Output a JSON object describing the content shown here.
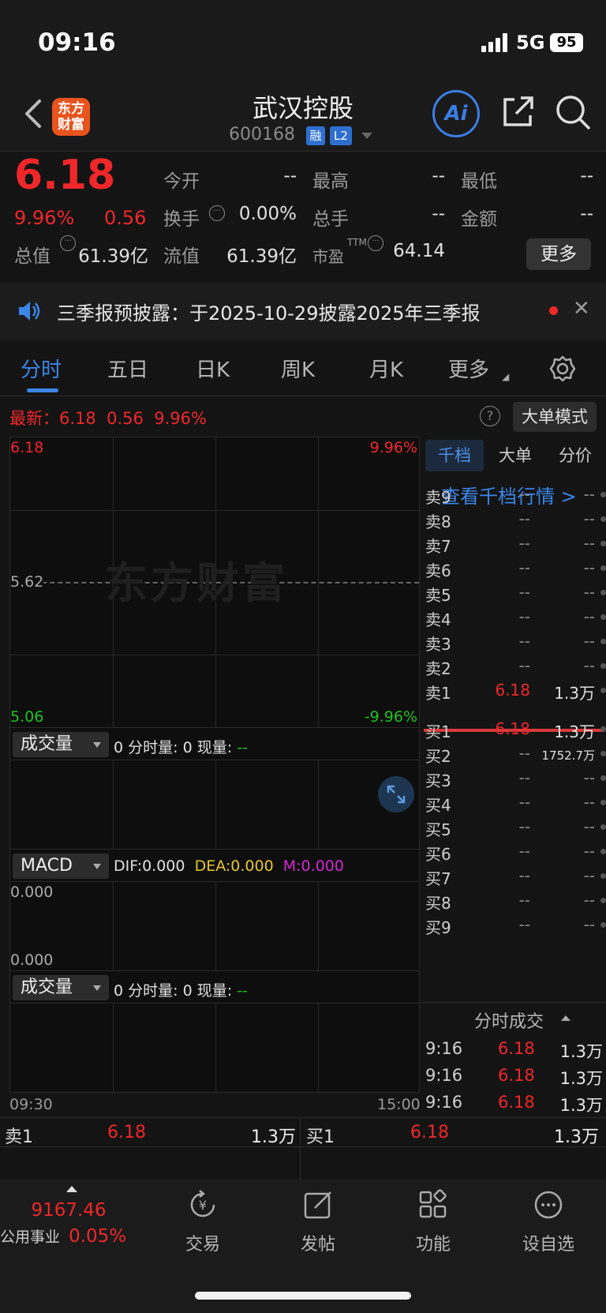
{
  "status": {
    "time": "09:16",
    "network": "5G",
    "battery": "95"
  },
  "header": {
    "title": "武汉控股",
    "code": "600168",
    "tag_margin": "融",
    "tag_level": "L2",
    "ai_label": "Ai"
  },
  "quote": {
    "price": "6.18",
    "change_pct": "9.96%",
    "change": "0.56",
    "open_label": "今开",
    "open": "--",
    "high_label": "最高",
    "high": "--",
    "low_label": "最低",
    "low": "--",
    "turnover_label": "换手",
    "turnover": "0.00%",
    "volume_label": "总手",
    "volume": "--",
    "amount_label": "金额",
    "amount": "--",
    "mktcap_label": "总值",
    "mktcap": "61.39亿",
    "float_label": "流值",
    "float": "61.39亿",
    "pe_label": "市盈",
    "pe_sup": "TTM",
    "pe": "64.14",
    "more": "更多"
  },
  "notice": {
    "text": "三季报预披露：于2025-10-29披露2025年三季报"
  },
  "tabs": [
    "分时",
    "五日",
    "日K",
    "周K",
    "月K",
    "更多"
  ],
  "latest": {
    "label": "最新：",
    "price": "6.18",
    "change": "0.56",
    "pct": "9.96%",
    "mode_btn": "大单模式",
    "help": "?"
  },
  "chart": {
    "top_price": "6.18",
    "top_pct": "9.96%",
    "mid_price": "5.62",
    "bottom_price": "5.06",
    "bottom_pct": "-9.96%",
    "watermark": "东方财富",
    "start_time": "09:30",
    "end_time": "15:00"
  },
  "volume1": {
    "label": "成交量",
    "text_a": "0",
    "lbl_a": "分时量:",
    "text_b": "0",
    "lbl_b": "现量:",
    "text_c": "--"
  },
  "macd": {
    "label": "MACD",
    "dif": "DIF:0.000",
    "dea": "DEA:0.000",
    "m": "M:0.000",
    "top": "0.000",
    "bottom": "0.000"
  },
  "volume2": {
    "label": "成交量",
    "text_a": "0",
    "lbl_a": "分时量:",
    "text_b": "0",
    "lbl_b": "现量:",
    "text_c": "--"
  },
  "book": {
    "tabs": [
      "千档",
      "大单",
      "分价"
    ],
    "view_link": "查看千档行情 >",
    "asks": [
      {
        "label": "卖9",
        "price": "--",
        "vol": "--"
      },
      {
        "label": "卖8",
        "price": "--",
        "vol": "--"
      },
      {
        "label": "卖7",
        "price": "--",
        "vol": "--"
      },
      {
        "label": "卖6",
        "price": "--",
        "vol": "--"
      },
      {
        "label": "卖5",
        "price": "--",
        "vol": "--"
      },
      {
        "label": "卖4",
        "price": "--",
        "vol": "--"
      },
      {
        "label": "卖3",
        "price": "--",
        "vol": "--"
      },
      {
        "label": "卖2",
        "price": "--",
        "vol": "--"
      },
      {
        "label": "卖1",
        "price": "6.18",
        "vol": "1.3万"
      }
    ],
    "bids": [
      {
        "label": "买1",
        "price": "6.18",
        "vol": "1.3万"
      },
      {
        "label": "买2",
        "price": "--",
        "vol": "1752.7万"
      },
      {
        "label": "买3",
        "price": "--",
        "vol": "--"
      },
      {
        "label": "买4",
        "price": "--",
        "vol": "--"
      },
      {
        "label": "买5",
        "price": "--",
        "vol": "--"
      },
      {
        "label": "买6",
        "price": "--",
        "vol": "--"
      },
      {
        "label": "买7",
        "price": "--",
        "vol": "--"
      },
      {
        "label": "买8",
        "price": "--",
        "vol": "--"
      },
      {
        "label": "买9",
        "price": "--",
        "vol": "--"
      }
    ],
    "ticks_title": "分时成交",
    "ticks": [
      {
        "time": "9:16",
        "price": "6.18",
        "vol": "1.3万"
      },
      {
        "time": "9:16",
        "price": "6.18",
        "vol": "1.3万"
      },
      {
        "time": "9:16",
        "price": "6.18",
        "vol": "1.3万"
      }
    ]
  },
  "quote_row": {
    "left_label": "卖1",
    "left_price": "6.18",
    "left_vol": "1.3万",
    "right_label": "买1",
    "right_price": "6.18",
    "right_vol": "1.3万"
  },
  "nav": {
    "index_value": "9167.46",
    "index_name": "公用事业",
    "index_pct": "0.05%",
    "items": [
      "交易",
      "发帖",
      "功能",
      "设自选"
    ]
  },
  "colors": {
    "up": "#f0272a",
    "down": "#1ec31e",
    "accent": "#3b86e8",
    "brand": "#e8531e"
  }
}
